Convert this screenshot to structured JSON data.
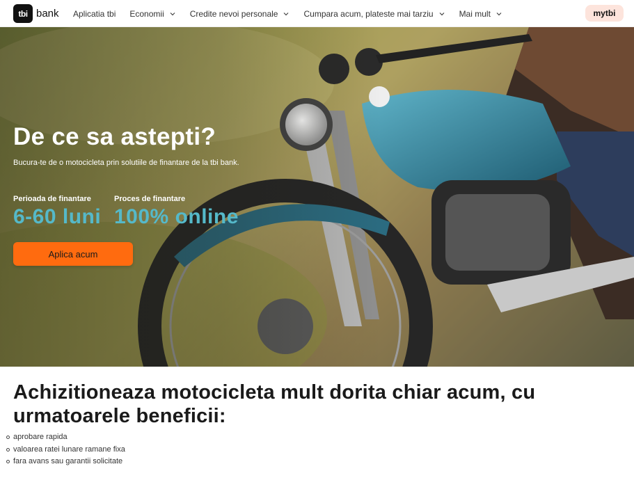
{
  "nav": {
    "logo_mark": "tbi",
    "logo_text": "bank",
    "items": [
      {
        "label": "Aplicatia tbi",
        "has_dropdown": false
      },
      {
        "label": "Economii",
        "has_dropdown": true
      },
      {
        "label": "Credite nevoi personale",
        "has_dropdown": true
      },
      {
        "label": "Cumpara acum, plateste mai tarziu",
        "has_dropdown": true
      },
      {
        "label": "Mai mult",
        "has_dropdown": true
      }
    ],
    "account_button": "mytbi"
  },
  "hero": {
    "title": "De ce sa astepti?",
    "subtitle": "Bucura-te de o motocicleta prin solutiile de finantare de la tbi bank.",
    "stats": [
      {
        "label": "Perioada de finantare",
        "value": "6-60 luni"
      },
      {
        "label": "Proces de finantare",
        "value": "100% online"
      }
    ],
    "cta": "Aplica acum"
  },
  "benefits": {
    "title": "Achizitioneaza motocicleta mult dorita chiar acum, cu urmatoarele beneficii:",
    "items": [
      "aprobare rapida",
      "valoarea ratei lunare ramane fixa",
      "fara avans sau garantii solicitate"
    ]
  },
  "colors": {
    "accent_orange": "#ff6b0f",
    "accent_teal": "#55b9c9",
    "account_button_bg": "#fde4dc"
  }
}
